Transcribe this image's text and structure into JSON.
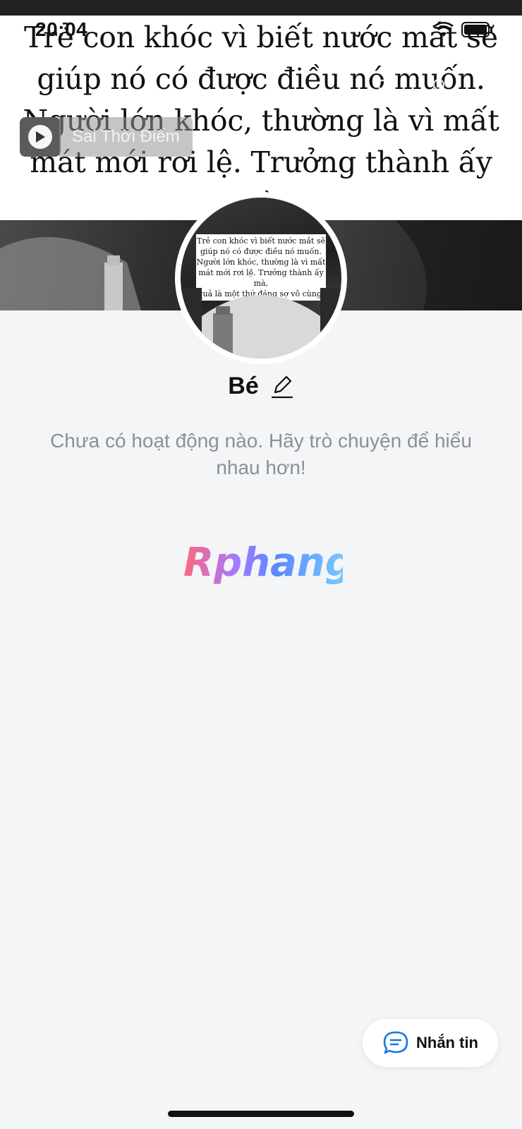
{
  "status_bar": {
    "time": "20:04"
  },
  "cover": {
    "quote_text": "Trẻ con khóc vì biết nước mắt sẽ\ngiúp nó có được điều nó muốn.\nNgười lớn khóc, thường là vì mất\nmát mới rơi lệ. Trưởng thành ấy mà,\nquả là một thứ đáng sợ vô cùng."
  },
  "nav": {
    "back_icon": "chevron-left-icon",
    "call_icon": "phone-icon",
    "settings_icon": "user-settings-icon",
    "more_icon": "more-dots-icon"
  },
  "music": {
    "title": "Sai Thời Điểm",
    "icon": "play-icon"
  },
  "avatar": {
    "quote_text": "Trẻ con khóc vì biết nước mắt sẽ\ngiúp nó có được điều nó muốn.\nNgười lớn khóc, thường là vì mất\nmát mới rơi lệ. Trưởng thành ấy mà,\nquả là một thứ đáng sợ vô cùng."
  },
  "profile": {
    "name": "Bé",
    "edit_icon": "pencil-icon",
    "empty_message": "Chưa có hoạt động nào. Hãy trò chuyện để hiểu nhau hơn!"
  },
  "watermark": {
    "text": "Rphang"
  },
  "message_button": {
    "label": "Nhắn tin",
    "icon": "chat-bubble-icon"
  },
  "colors": {
    "background": "#f4f5f7",
    "muted_text": "#8a9098",
    "accent": "#1a73e8"
  }
}
